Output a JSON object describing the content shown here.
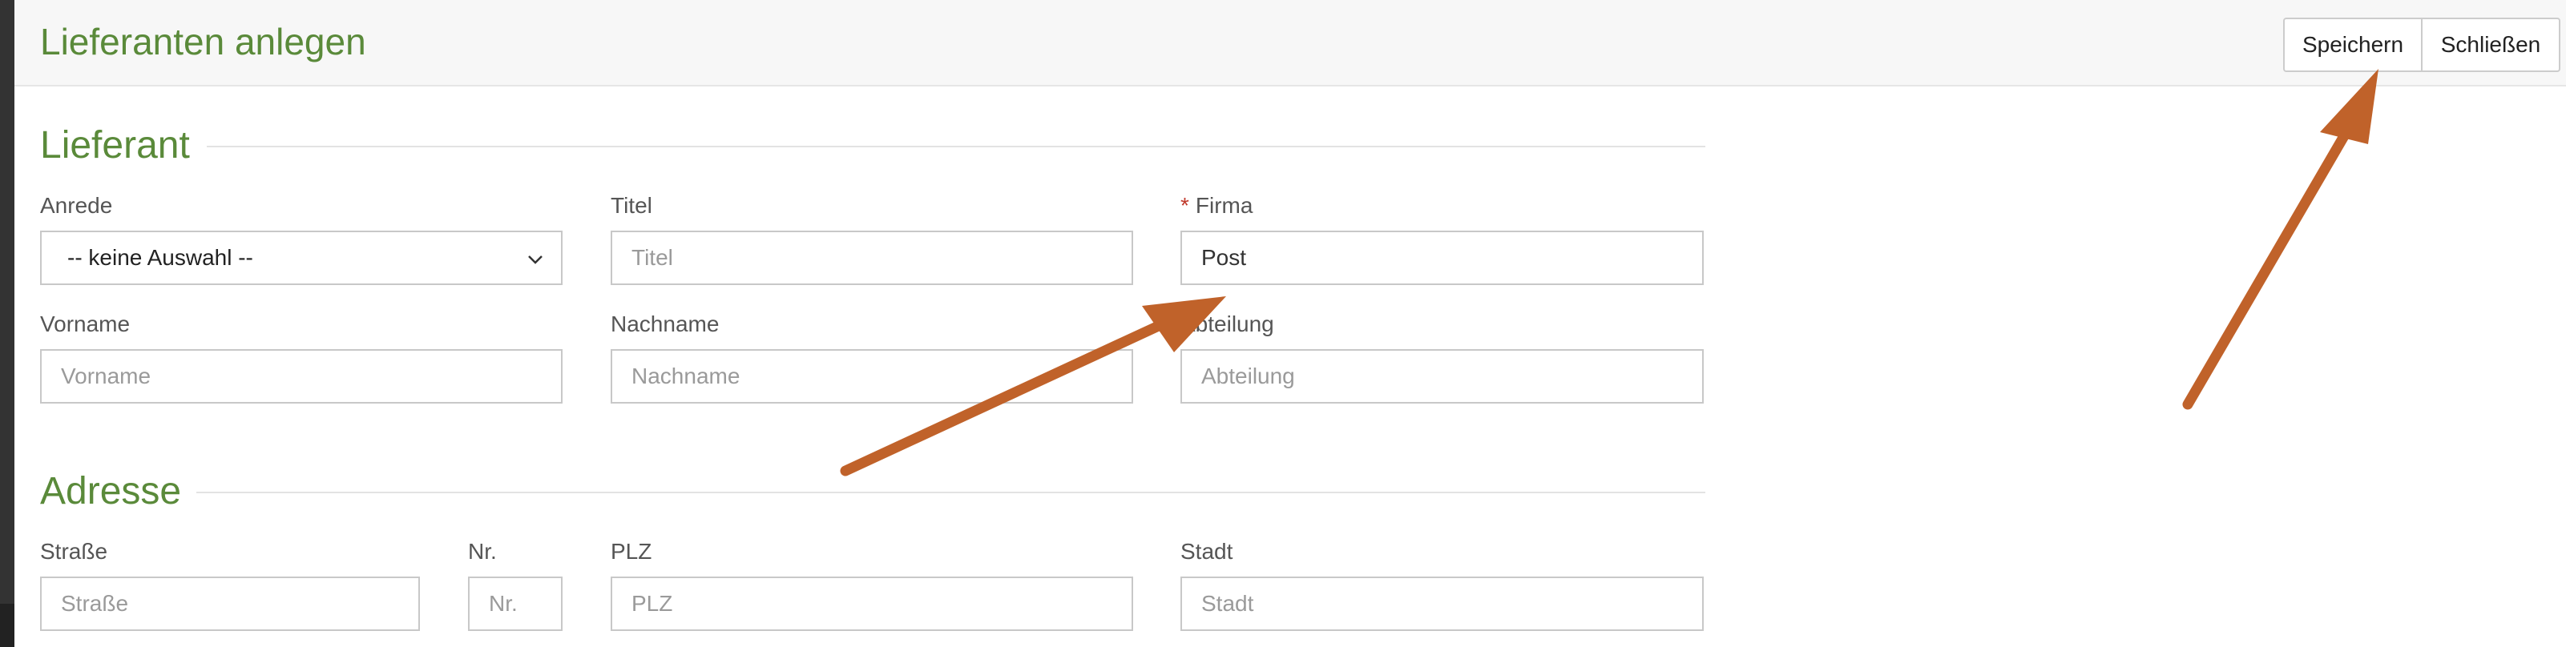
{
  "header": {
    "title": "Lieferanten anlegen",
    "save_label": "Speichern",
    "close_label": "Schließen"
  },
  "lieferant": {
    "section_title": "Lieferant",
    "anrede": {
      "label": "Anrede",
      "value": "-- keine Auswahl --"
    },
    "titel": {
      "label": "Titel",
      "placeholder": "Titel"
    },
    "firma": {
      "required_mark": "*",
      "label": "Firma",
      "value": "Post"
    },
    "vorname": {
      "label": "Vorname",
      "placeholder": "Vorname"
    },
    "nachname": {
      "label": "Nachname",
      "placeholder": "Nachname"
    },
    "abteilung": {
      "label": "Abteilung",
      "placeholder": "Abteilung"
    }
  },
  "adresse": {
    "section_title": "Adresse",
    "strasse": {
      "label": "Straße",
      "placeholder": "Straße"
    },
    "nr": {
      "label": "Nr.",
      "placeholder": "Nr."
    },
    "plz": {
      "label": "PLZ",
      "placeholder": "PLZ"
    },
    "stadt": {
      "label": "Stadt",
      "placeholder": "Stadt"
    }
  },
  "icons": {
    "select_chevron": "chevron-down-icon",
    "annotation_arrows": "arrow-icon"
  },
  "colors": {
    "accent_green": "#5a8a3a",
    "annotation_orange": "#c0622a",
    "required_red": "#c0392b"
  }
}
